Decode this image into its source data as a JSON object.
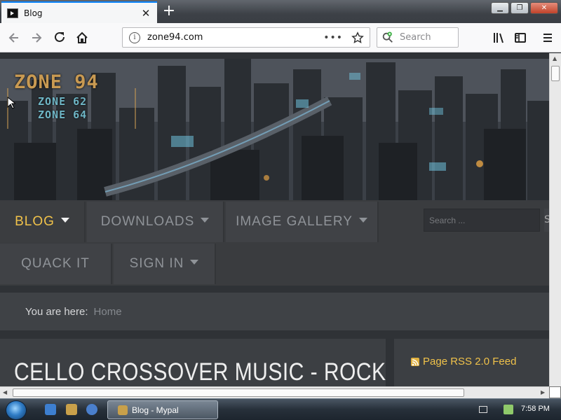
{
  "browser": {
    "tab_title": "Blog",
    "url": "zone94.com",
    "url_dots": "•••",
    "search_placeholder": "Search"
  },
  "site": {
    "logo": "ZONE 94",
    "logo_sub1": "ZONE 62",
    "logo_sub2": "ZONE 64",
    "menu": [
      {
        "label": "BLOG",
        "active": true
      },
      {
        "label": "DOWNLOADS"
      },
      {
        "label": "IMAGE GALLERY"
      },
      {
        "label": "QUACK IT"
      },
      {
        "label": "SIGN IN"
      }
    ],
    "nav_search_placeholder": "Search ...",
    "nav_search_btn": "S",
    "breadcrumb_label": "You are here:",
    "breadcrumb_home": "Home",
    "article_title": "CELLO CROSSOVER MUSIC - ROCK",
    "rss_link": "Page RSS 2.0 Feed"
  },
  "taskbar": {
    "task_label": "Blog - Mypal",
    "clock": "7:58 PM"
  },
  "colors": {
    "accent": "#f0c24a",
    "firefox_blue": "#0a84ff"
  }
}
